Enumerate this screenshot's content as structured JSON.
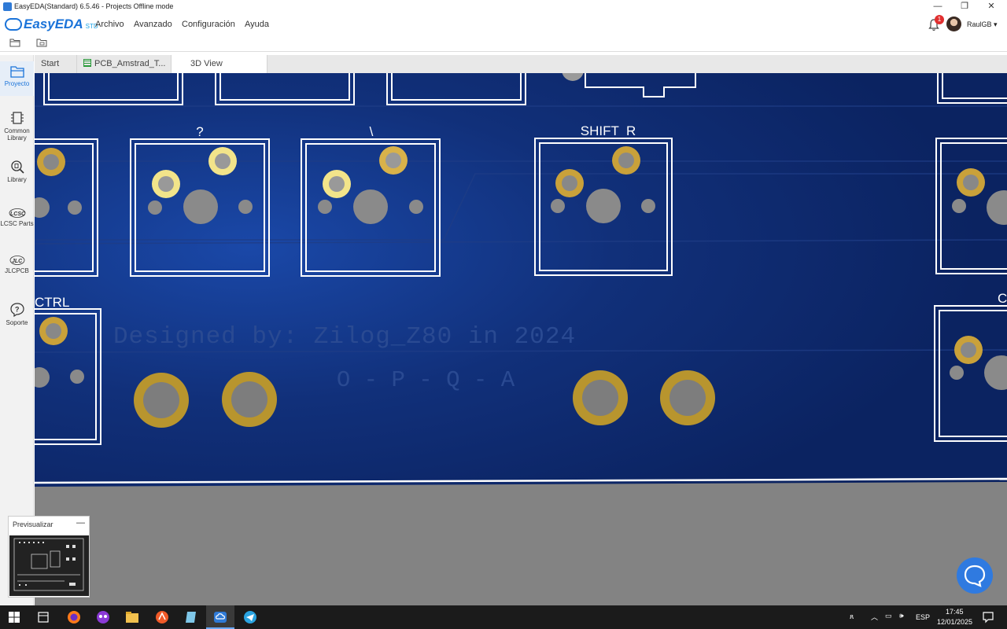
{
  "window": {
    "title": "EasyEDA(Standard) 6.5.46 - Projects Offline mode"
  },
  "brand": {
    "name": "EasyEDA",
    "edition": "STD"
  },
  "menu": [
    "Archivo",
    "Avanzado",
    "Configuración",
    "Ayuda"
  ],
  "notifications": {
    "count": "1"
  },
  "user": {
    "name": "RaulGB"
  },
  "leftnav": {
    "items": [
      {
        "label": "Proyecto",
        "icon": "folder-icon"
      },
      {
        "label": "Common Library",
        "icon": "chip-icon"
      },
      {
        "label": "Library",
        "icon": "library-search-icon"
      },
      {
        "label": "LCSC Parts",
        "icon": "lcsc-icon"
      },
      {
        "label": "JLCPCB",
        "icon": "jlc-icon"
      },
      {
        "label": "Soporte",
        "icon": "help-icon"
      }
    ]
  },
  "tabs": [
    {
      "label": "Start",
      "active": false
    },
    {
      "label": "PCB_Amstrad_T...",
      "active": false
    },
    {
      "label": "3D View",
      "active": true
    }
  ],
  "pcb": {
    "key_labels": [
      "?",
      "\\",
      "SHIFT  R",
      "CTRL"
    ],
    "credit": "Designed by: Zilog_Z80 in 2024",
    "subcredit": "O - P - Q - A",
    "board_color": "#0e2a6b"
  },
  "preview": {
    "title": "Previsualizar",
    "minimize": "—"
  },
  "taskbar": {
    "time": "17:45",
    "date": "12/01/2025",
    "lang": "ESP"
  }
}
